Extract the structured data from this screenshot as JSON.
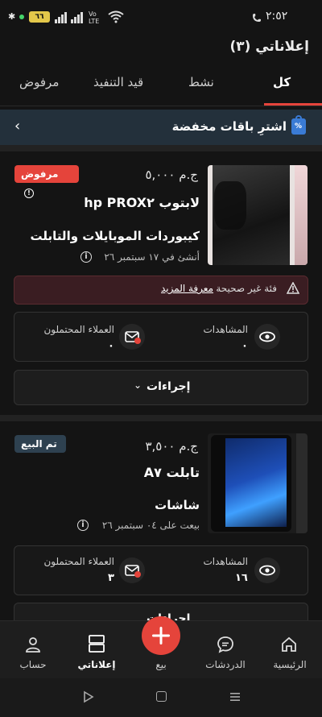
{
  "status_bar": {
    "time": "٢:٥٢",
    "battery": "٦٦",
    "network": "Vo LTE"
  },
  "page": {
    "title": "إعلاناتي (٣)"
  },
  "tabs": [
    {
      "label": "كل",
      "active": true
    },
    {
      "label": "نشط",
      "active": false
    },
    {
      "label": "قيد التنفيذ",
      "active": false
    },
    {
      "label": "مرفوض",
      "active": false
    }
  ],
  "promo": {
    "label": "اشترِ باقات مخفضة"
  },
  "ads": [
    {
      "badge": "مرفوض",
      "badge_color": "#e5443b",
      "price": "ج.م ٥,٠٠٠",
      "title": "لابتوب hp PROX٢",
      "category": "كيبوردات الموبايلات والتابلت",
      "date": "أنشئ في ١٧ سبتمبر ٢٦",
      "alert_text": "فئة غير صحيحة",
      "alert_link": "معرفة المزيد",
      "views_label": "المشاهدات",
      "views_value": "٠",
      "leads_label": "العملاء المحتملون",
      "leads_value": "٠",
      "actions_label": "إجراءات"
    },
    {
      "badge": "تم البيع",
      "badge_color": "#2e4150",
      "price": "ج.م ٣,٥٠٠",
      "title": "تابلت A٧",
      "category": "شاشات",
      "date": "بيعت على ٠٤ سبتمبر ٢٦",
      "views_label": "المشاهدات",
      "views_value": "١٦",
      "leads_label": "العملاء المحتملون",
      "leads_value": "٣",
      "actions_label": "إجراءات"
    }
  ],
  "bottom_nav": [
    {
      "label": "الرئيسية",
      "icon": "home-icon"
    },
    {
      "label": "الدردشات",
      "icon": "chat-icon"
    },
    {
      "label": "بيع",
      "icon": "plus-icon"
    },
    {
      "label": "إعلاناتي",
      "icon": "my-ads-icon",
      "active": true
    },
    {
      "label": "حساب",
      "icon": "account-icon"
    }
  ],
  "colors": {
    "accent": "#e5443b",
    "background": "#141414"
  }
}
